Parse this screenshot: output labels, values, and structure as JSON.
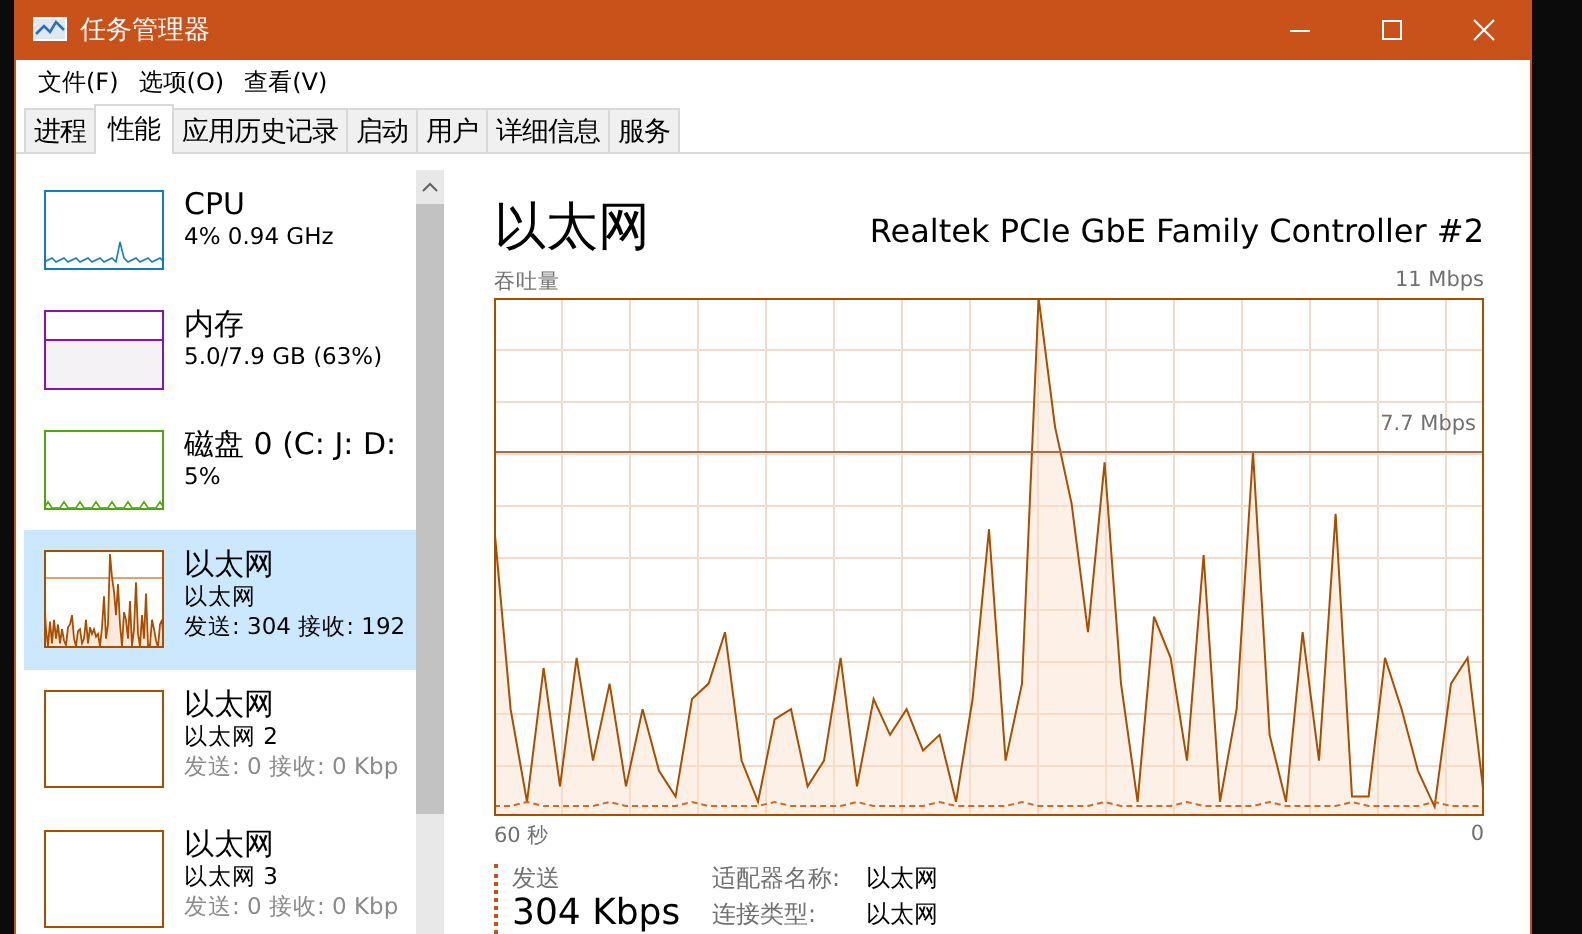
{
  "window": {
    "title": "任务管理器"
  },
  "menu": [
    {
      "label": "文件(F)"
    },
    {
      "label": "选项(O)"
    },
    {
      "label": "查看(V)"
    }
  ],
  "tabs": [
    {
      "label": "进程",
      "selected": false
    },
    {
      "label": "性能",
      "selected": true
    },
    {
      "label": "应用历史记录",
      "selected": false
    },
    {
      "label": "启动",
      "selected": false
    },
    {
      "label": "用户",
      "selected": false
    },
    {
      "label": "详细信息",
      "selected": false
    },
    {
      "label": "服务",
      "selected": false
    }
  ],
  "sidebar": {
    "items": [
      {
        "kind": "cpu",
        "title": "CPU",
        "lines": [
          "4% 0.94 GHz"
        ],
        "selected": false,
        "disconnected": false
      },
      {
        "kind": "memory",
        "title": "内存",
        "lines": [
          "5.0/7.9 GB (63%)"
        ],
        "selected": false,
        "disconnected": false
      },
      {
        "kind": "disk",
        "title": "磁盘 0 (C: J: D:",
        "lines": [
          "5%"
        ],
        "selected": false,
        "disconnected": false
      },
      {
        "kind": "network",
        "title": "以太网",
        "lines": [
          "以太网",
          "发送: 304 接收: 192"
        ],
        "selected": true,
        "disconnected": false
      },
      {
        "kind": "network",
        "title": "以太网",
        "lines": [
          "以太网 2",
          "发送: 0 接收: 0 Kbp"
        ],
        "selected": false,
        "disconnected": true
      },
      {
        "kind": "network",
        "title": "以太网",
        "lines": [
          "以太网 3",
          "发送: 0 接收: 0 Kbp"
        ],
        "selected": false,
        "disconnected": true
      }
    ]
  },
  "detail": {
    "title": "以太网",
    "device": "Realtek PCIe GbE Family Controller #2",
    "graph_label": "吞吐量",
    "graph_max": "11 Mbps",
    "reference_line": "7.7 Mbps",
    "time_start": "60 秒",
    "time_end": "0",
    "send": {
      "label": "发送",
      "value": "304 Kbps"
    },
    "properties": [
      {
        "label": "适配器名称:",
        "value": "以太网"
      },
      {
        "label": "连接类型:",
        "value": "以太网"
      }
    ]
  }
}
